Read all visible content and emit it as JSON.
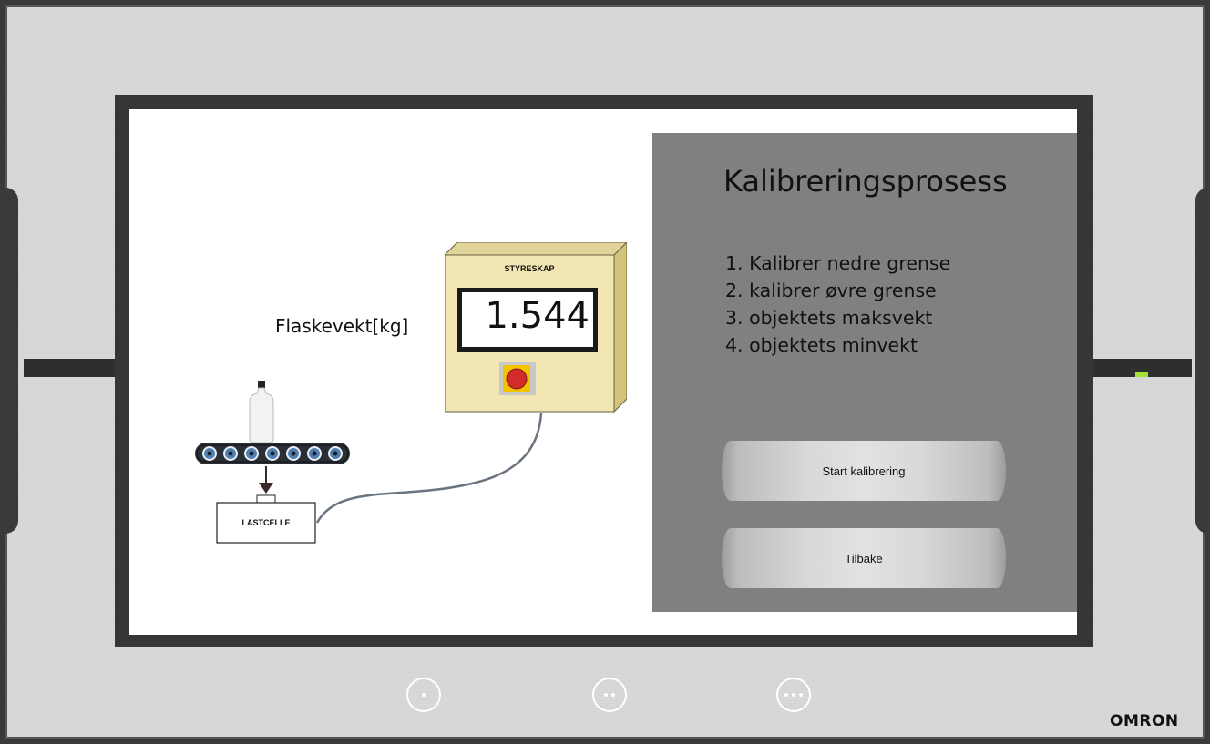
{
  "screen": {
    "weight_label": "Flaskevekt[kg]",
    "cabinet_label": "STYRESKAP",
    "weight_value": "1.544",
    "loadcell_label": "LASTCELLE"
  },
  "panel": {
    "title": "Kalibreringsprosess",
    "steps": [
      "1. Kalibrer nedre grense",
      "2. kalibrer øvre grense",
      "3. objektets maksvekt",
      "4. objektets minvekt"
    ],
    "start_button": "Start kalibrering",
    "back_button": "Tilbake"
  },
  "device": {
    "brand": "OMRON"
  },
  "colors": {
    "panel_bg": "#808080",
    "cabinet_face": "#f2e6b3",
    "led": "#a6e22e"
  }
}
